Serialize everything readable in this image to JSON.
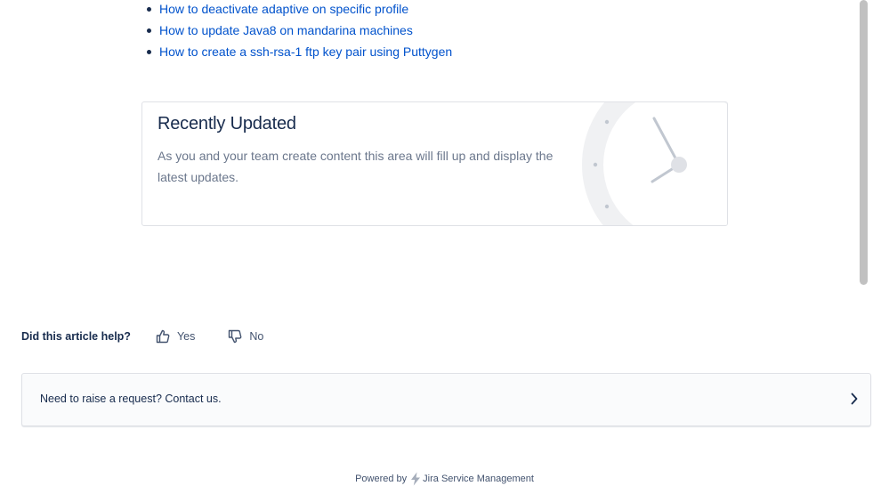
{
  "links": [
    {
      "label": "How to deactivate adaptive on specific profile"
    },
    {
      "label": "How to update Java8 on mandarina machines"
    },
    {
      "label": "How to create a ssh-rsa-1 ftp key pair using Puttygen"
    }
  ],
  "recently_updated": {
    "title": "Recently Updated",
    "body": "As you and your team create content this area will fill up and display the latest updates.",
    "icon": "clock-icon"
  },
  "feedback": {
    "question": "Did this article help?",
    "yes_label": "Yes",
    "no_label": "No",
    "yes_icon": "thumbs-up-icon",
    "no_icon": "thumbs-down-icon"
  },
  "contact": {
    "label": "Need to raise a request? Contact us.",
    "icon": "chevron-right-icon"
  },
  "footer": {
    "powered_by": "Powered by",
    "product": "Jira Service Management",
    "icon": "lightning-bolt-icon"
  },
  "colors": {
    "link": "#0052cc",
    "text": "#172b4d",
    "muted": "#6b778c",
    "border": "#dfe1e6"
  }
}
